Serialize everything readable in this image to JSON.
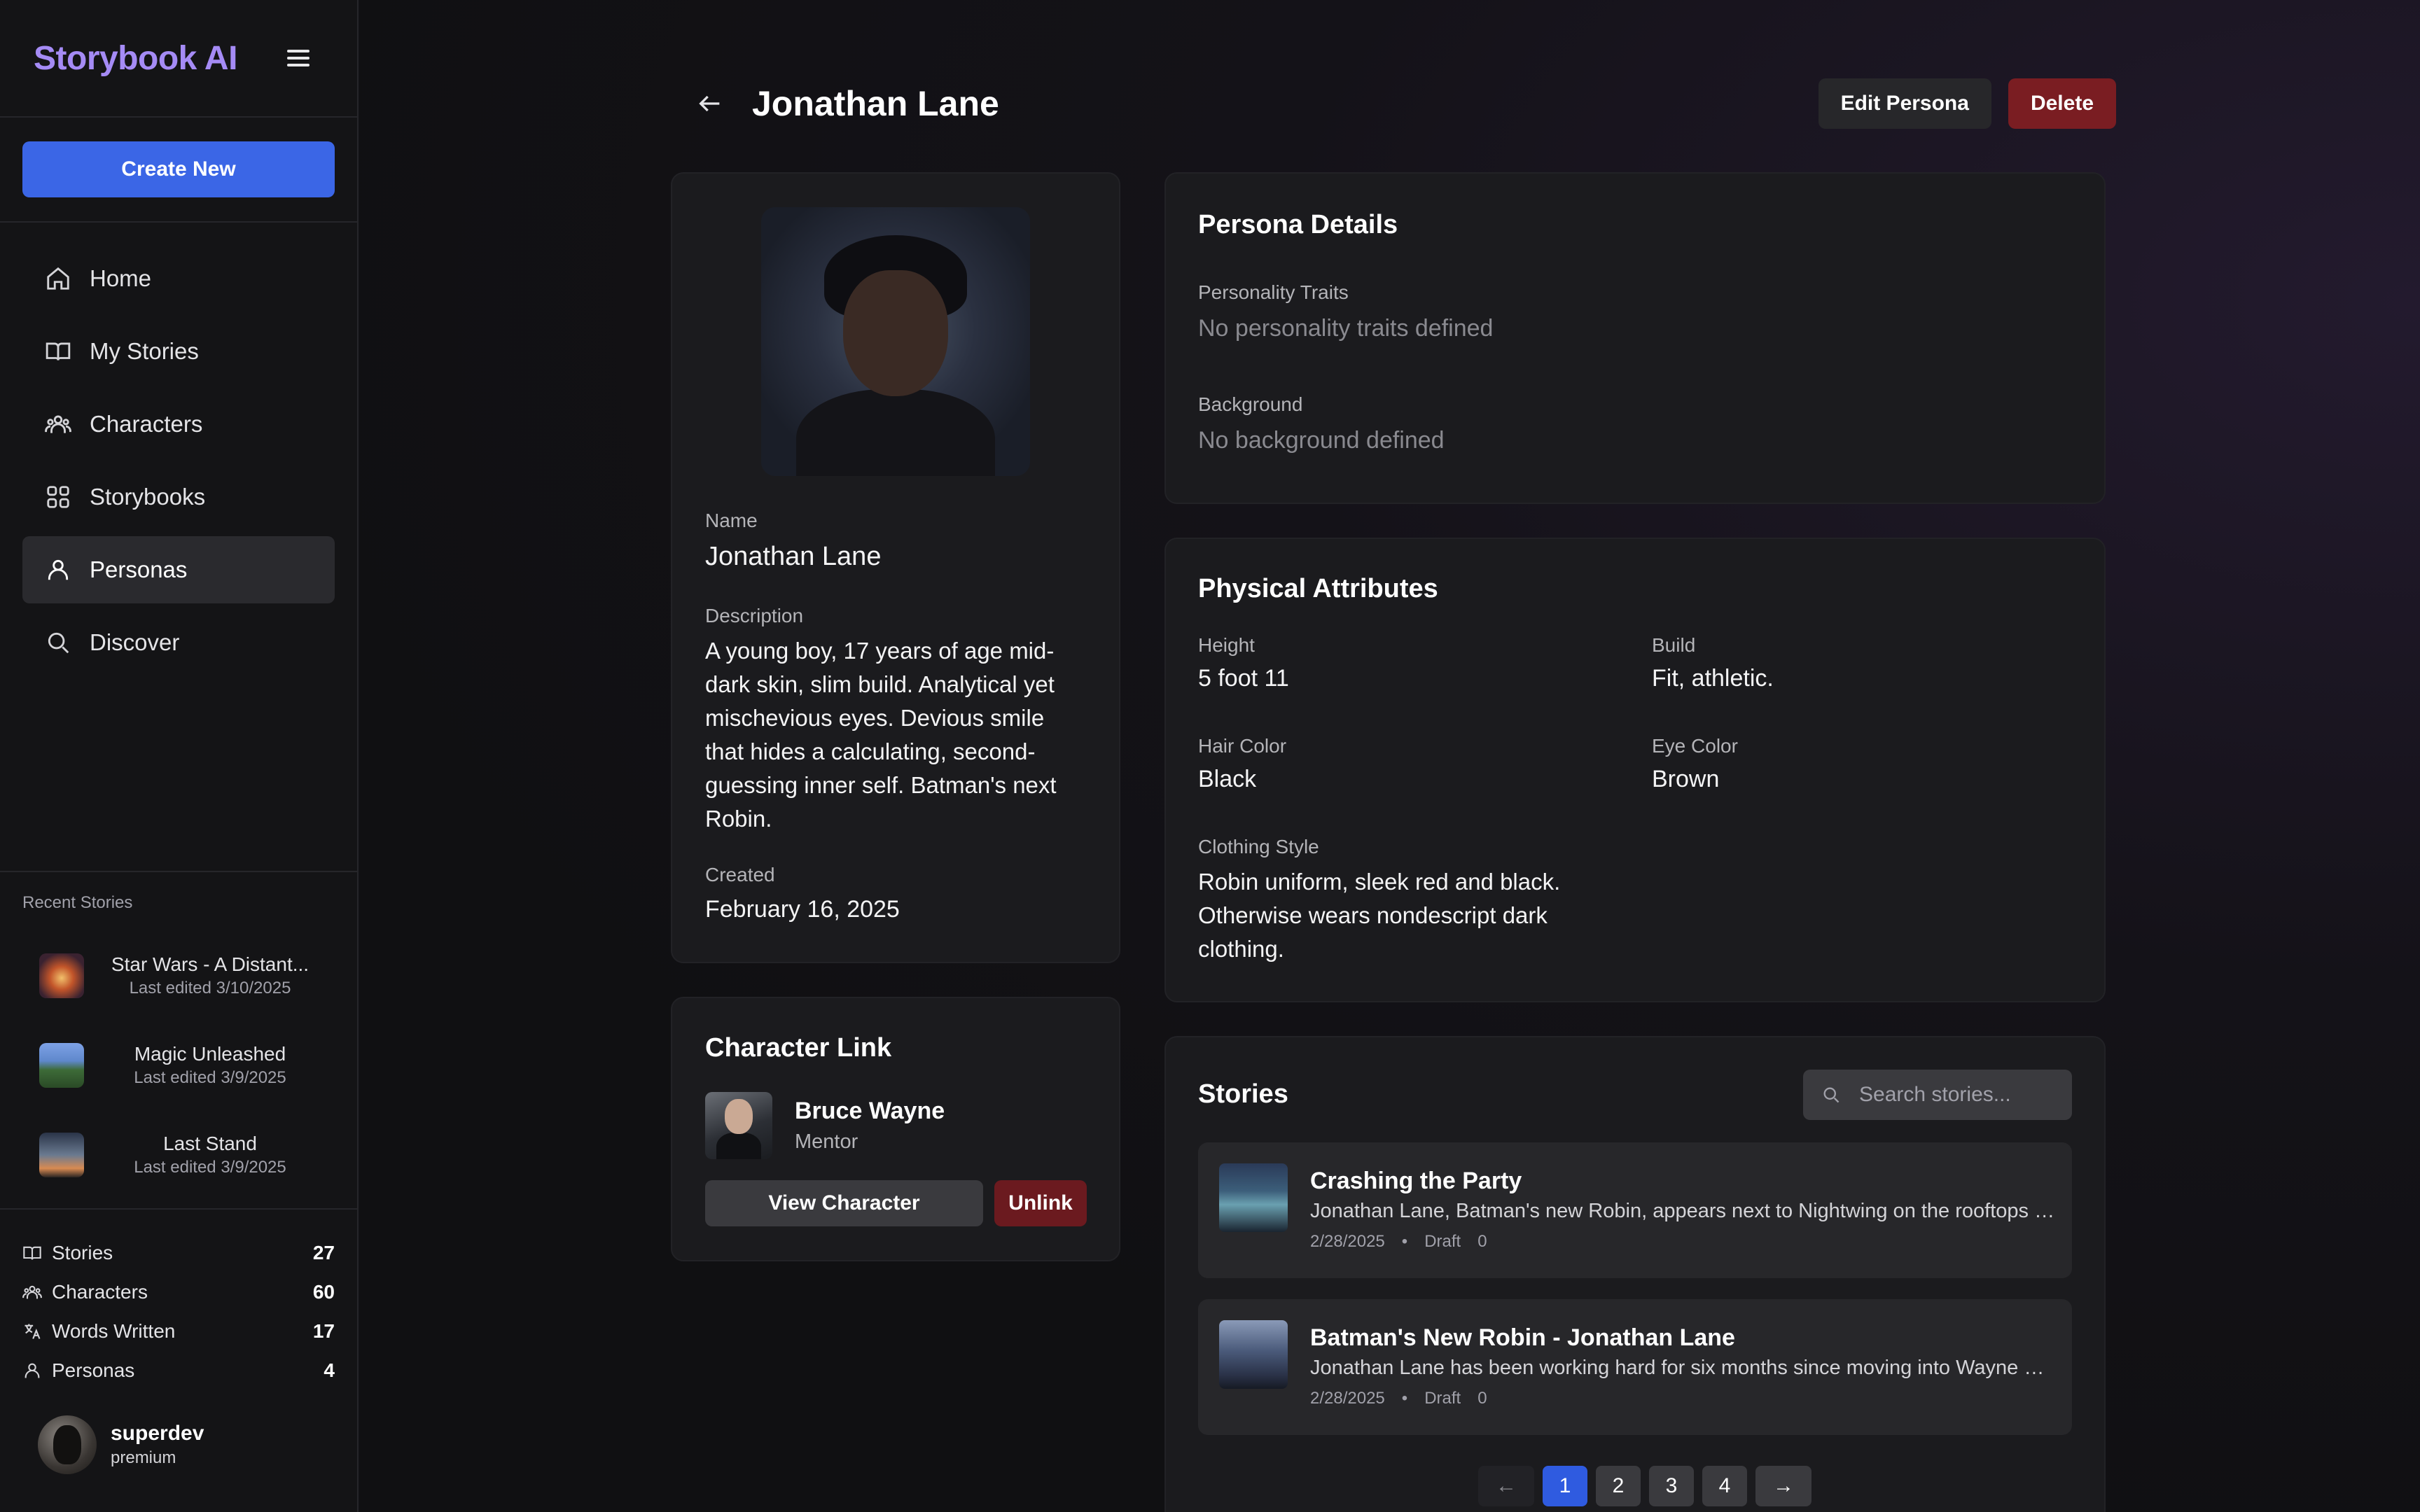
{
  "app": {
    "brand": "Storybook AI"
  },
  "sidebar": {
    "create_label": "Create New",
    "nav": [
      {
        "label": "Home",
        "icon": "home-icon"
      },
      {
        "label": "My Stories",
        "icon": "book-icon"
      },
      {
        "label": "Characters",
        "icon": "users-icon"
      },
      {
        "label": "Storybooks",
        "icon": "grid-icon"
      },
      {
        "label": "Personas",
        "icon": "user-icon",
        "active": true
      },
      {
        "label": "Discover",
        "icon": "search-icon"
      }
    ],
    "recent_title": "Recent Stories",
    "recent": [
      {
        "name": "Star Wars - A Distant...",
        "date": "Last edited 3/10/2025"
      },
      {
        "name": "Magic Unleashed",
        "date": "Last edited 3/9/2025"
      },
      {
        "name": "Last Stand",
        "date": "Last edited 3/9/2025"
      }
    ],
    "stats": [
      {
        "label": "Stories",
        "value": "27"
      },
      {
        "label": "Characters",
        "value": "60"
      },
      {
        "label": "Words Written",
        "value": "17"
      },
      {
        "label": "Personas",
        "value": "4"
      }
    ],
    "user": {
      "name": "superdev",
      "role": "premium"
    }
  },
  "header": {
    "title": "Jonathan Lane",
    "edit_label": "Edit Persona",
    "delete_label": "Delete"
  },
  "profile": {
    "name_label": "Name",
    "name": "Jonathan Lane",
    "description_label": "Description",
    "description": "A young boy, 17 years of age mid-dark skin, slim build. Analytical yet mischevious eyes. Devious smile that hides a calculating, second-guessing inner self. Batman's next Robin.",
    "created_label": "Created",
    "created": "February 16, 2025"
  },
  "character_link": {
    "title": "Character Link",
    "name": "Bruce Wayne",
    "role": "Mentor",
    "view_label": "View Character",
    "unlink_label": "Unlink"
  },
  "persona_details": {
    "title": "Persona Details",
    "traits_label": "Personality Traits",
    "traits_value": "No personality traits defined",
    "background_label": "Background",
    "background_value": "No background defined"
  },
  "physical": {
    "title": "Physical Attributes",
    "height_label": "Height",
    "height": "5 foot 11",
    "build_label": "Build",
    "build": "Fit, athletic.",
    "hair_label": "Hair Color",
    "hair": "Black",
    "eye_label": "Eye Color",
    "eye": "Brown",
    "clothing_label": "Clothing Style",
    "clothing": "Robin uniform, sleek red and black. Otherwise wears nondescript dark clothing."
  },
  "stories": {
    "title": "Stories",
    "search_placeholder": "Search stories...",
    "items": [
      {
        "title": "Crashing the Party",
        "desc": "Jonathan Lane, Batman's new Robin, appears next to Nightwing on the rooftops of Gotham...",
        "date": "2/28/2025",
        "dot": "•",
        "status": "Draft",
        "count": "0"
      },
      {
        "title": "Batman's New Robin - Jonathan Lane",
        "desc": "Jonathan Lane has been working hard for six months since moving into Wayne Manor...",
        "date": "2/28/2025",
        "dot": "•",
        "status": "Draft",
        "count": "0"
      }
    ],
    "pager": {
      "prev": "←",
      "pages": [
        "1",
        "2",
        "3",
        "4"
      ],
      "next": "→"
    }
  },
  "colors": {
    "accent": "#3b66e6",
    "brand": "#a58bf5",
    "danger": "#7a1d22"
  }
}
